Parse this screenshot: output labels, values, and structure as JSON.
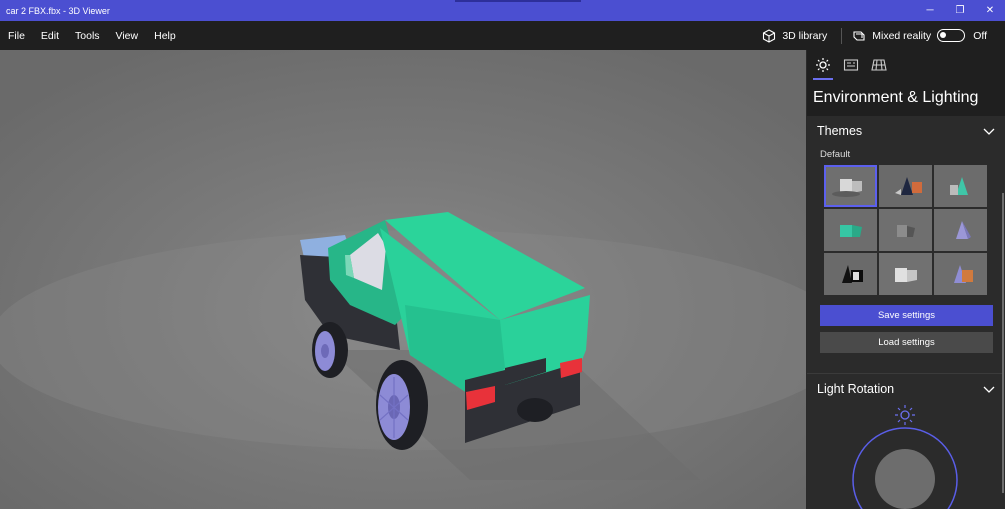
{
  "window": {
    "title": "car 2 FBX.fbx - 3D Viewer",
    "controls": {
      "minimize": "─",
      "restore": "❐",
      "close": "✕"
    }
  },
  "menu": {
    "items": [
      "File",
      "Edit",
      "Tools",
      "View",
      "Help"
    ],
    "library_label": "3D library",
    "mixed_reality_label": "Mixed reality",
    "mixed_reality_state": "Off"
  },
  "panel": {
    "title": "Environment & Lighting",
    "themes": {
      "heading": "Themes",
      "group_label": "Default",
      "selected_index": 0
    },
    "save_label": "Save settings",
    "load_label": "Load settings",
    "light_rotation_heading": "Light Rotation"
  },
  "colors": {
    "accent": "#4b4fd1",
    "car_body": "#2bd49a",
    "wheel": "#8d8bd6",
    "tail_light": "#e8323a"
  }
}
